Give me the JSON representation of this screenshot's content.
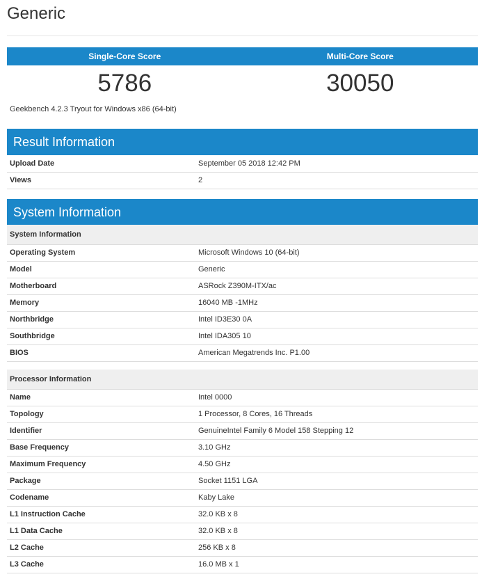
{
  "page": {
    "title": "Generic"
  },
  "scores": {
    "single_label": "Single-Core Score",
    "multi_label": "Multi-Core Score",
    "single_value": "5786",
    "multi_value": "30050",
    "version": "Geekbench 4.2.3 Tryout for Windows x86 (64-bit)"
  },
  "result_info": {
    "title": "Result Information",
    "rows": [
      {
        "key": "Upload Date",
        "value": "September 05 2018 12:42 PM"
      },
      {
        "key": "Views",
        "value": "2"
      }
    ]
  },
  "system_info": {
    "title": "System Information",
    "system_subhead": "System Information",
    "system_rows": [
      {
        "key": "Operating System",
        "value": "Microsoft Windows 10 (64-bit)"
      },
      {
        "key": "Model",
        "value": "Generic"
      },
      {
        "key": "Motherboard",
        "value": "ASRock Z390M-ITX/ac"
      },
      {
        "key": "Memory",
        "value": "16040 MB -1MHz"
      },
      {
        "key": "Northbridge",
        "value": "Intel ID3E30 0A"
      },
      {
        "key": "Southbridge",
        "value": "Intel IDA305 10"
      },
      {
        "key": "BIOS",
        "value": "American Megatrends Inc. P1.00"
      }
    ],
    "processor_subhead": "Processor Information",
    "processor_rows": [
      {
        "key": "Name",
        "value": "Intel 0000"
      },
      {
        "key": "Topology",
        "value": "1 Processor, 8 Cores, 16 Threads"
      },
      {
        "key": "Identifier",
        "value": "GenuineIntel Family 6 Model 158 Stepping 12"
      },
      {
        "key": "Base Frequency",
        "value": "3.10 GHz"
      },
      {
        "key": "Maximum Frequency",
        "value": "4.50 GHz"
      },
      {
        "key": "Package",
        "value": "Socket 1151 LGA"
      },
      {
        "key": "Codename",
        "value": "Kaby Lake"
      },
      {
        "key": "L1 Instruction Cache",
        "value": "32.0 KB x 8"
      },
      {
        "key": "L1 Data Cache",
        "value": "32.0 KB x 8"
      },
      {
        "key": "L2 Cache",
        "value": "256 KB x 8"
      },
      {
        "key": "L3 Cache",
        "value": "16.0 MB x 1"
      }
    ]
  },
  "colors": {
    "accent": "#1b87c9",
    "subhead_bg": "#efefef",
    "divider": "#dddddd"
  }
}
